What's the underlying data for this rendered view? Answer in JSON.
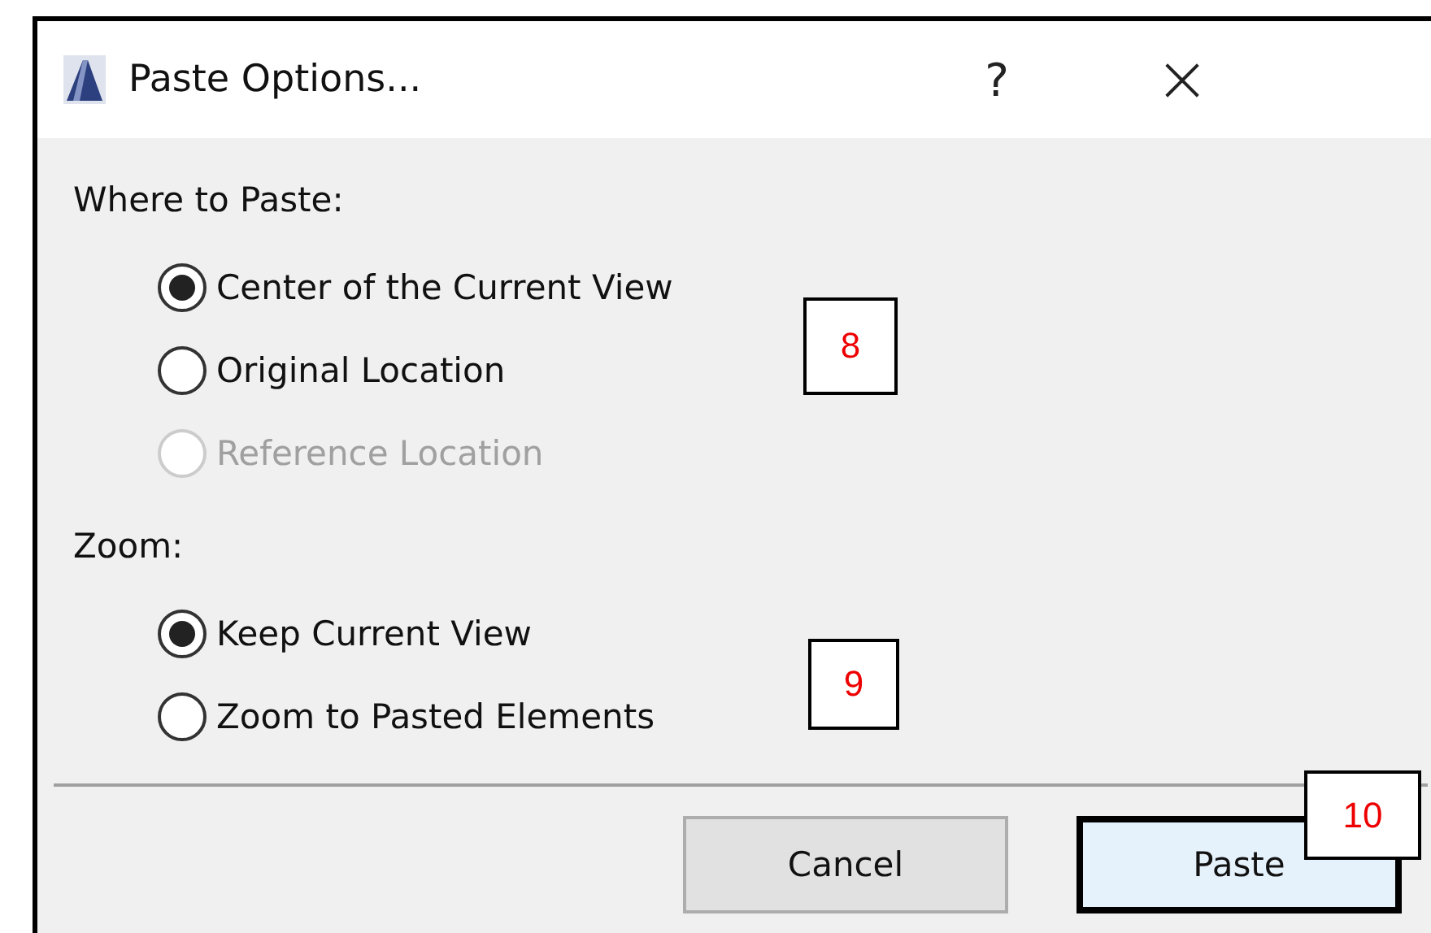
{
  "window": {
    "title": "Paste Options...",
    "help": "?",
    "close": "×"
  },
  "sections": [
    {
      "heading": "Where to Paste:",
      "options": [
        {
          "label": "Center of the Current View",
          "selected": true,
          "disabled": false
        },
        {
          "label": "Original Location",
          "selected": false,
          "disabled": false
        },
        {
          "label": "Reference Location",
          "selected": false,
          "disabled": true
        }
      ]
    },
    {
      "heading": "Zoom:",
      "options": [
        {
          "label": "Keep Current View",
          "selected": true,
          "disabled": false
        },
        {
          "label": "Zoom to Pasted Elements",
          "selected": false,
          "disabled": false
        }
      ]
    }
  ],
  "buttons": [
    {
      "label": "Cancel",
      "default": false
    },
    {
      "label": "Paste",
      "default": true
    }
  ],
  "callouts": [
    "8",
    "9",
    "10"
  ]
}
